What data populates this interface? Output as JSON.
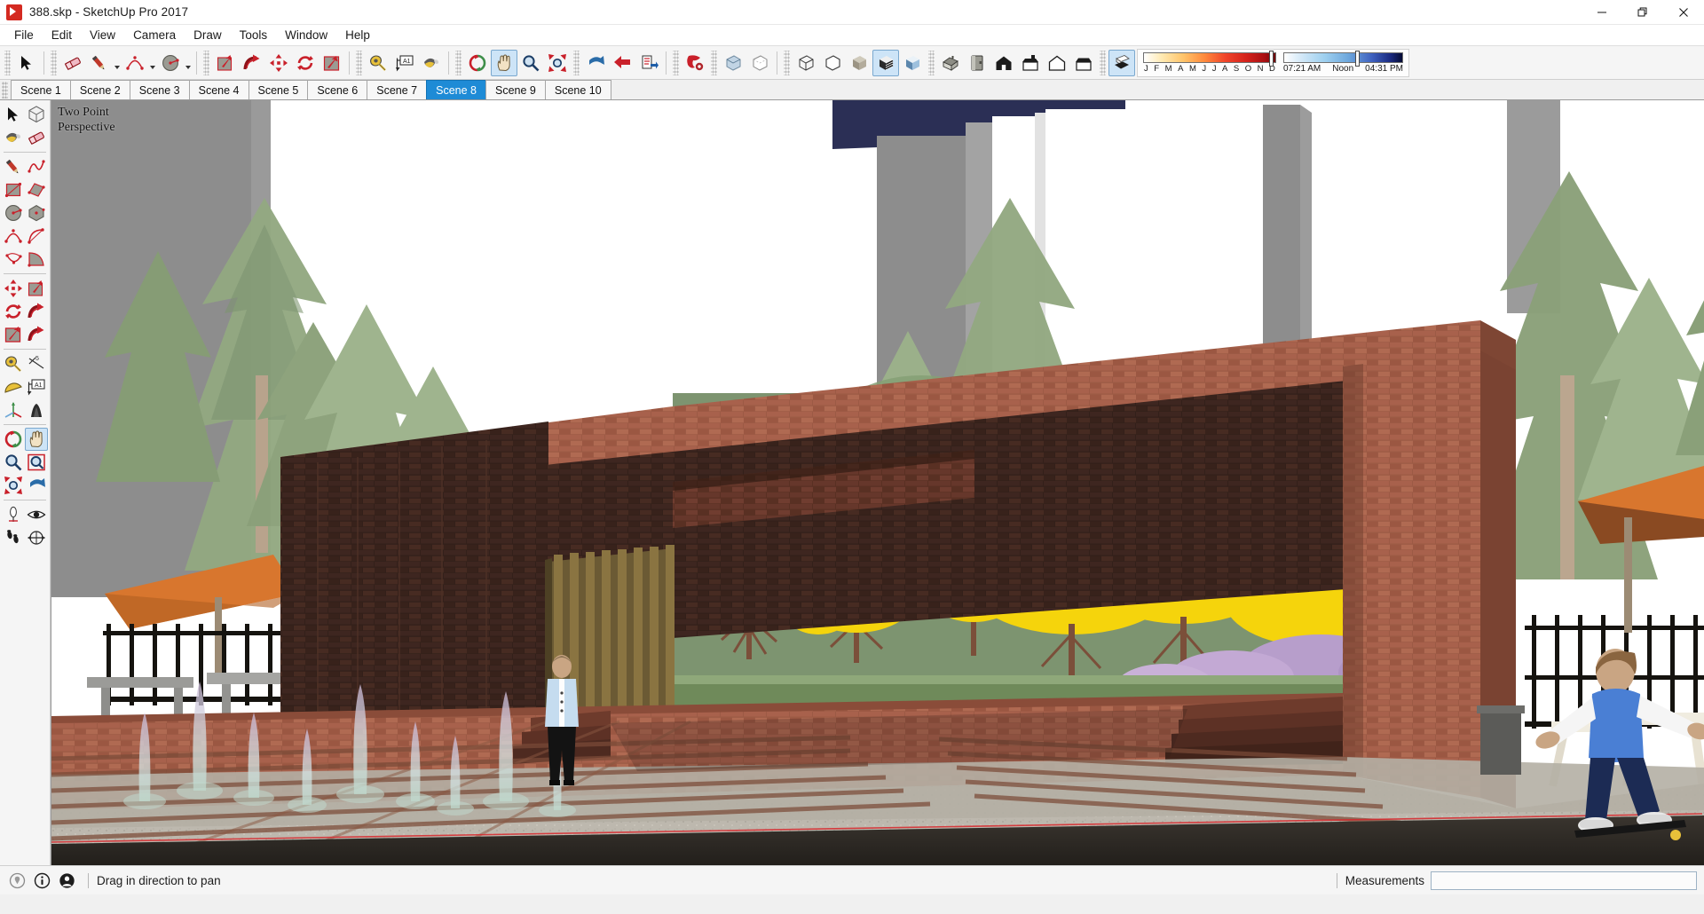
{
  "window": {
    "title": "388.skp - SketchUp Pro 2017",
    "app_icon": "sketchup-logo-icon",
    "minimize_label": "—",
    "maximize_label": "❐",
    "close_label": "✕"
  },
  "menubar": {
    "items": [
      {
        "label": "File"
      },
      {
        "label": "Edit"
      },
      {
        "label": "View"
      },
      {
        "label": "Camera"
      },
      {
        "label": "Draw"
      },
      {
        "label": "Tools"
      },
      {
        "label": "Window"
      },
      {
        "label": "Help"
      }
    ]
  },
  "toolbar_top": {
    "groups": [
      {
        "name": "select-group",
        "buttons": [
          {
            "name": "select-tool",
            "title": "Select",
            "icon": "arrow-cursor-icon",
            "active": false
          }
        ]
      },
      {
        "name": "draw-modify-group",
        "buttons": [
          {
            "name": "eraser-tool",
            "title": "Eraser",
            "icon": "eraser-icon",
            "active": false
          },
          {
            "name": "line-tool",
            "title": "Line",
            "icon": "pencil-icon",
            "active": false,
            "caret": true
          },
          {
            "name": "arc-tool",
            "title": "Arc",
            "icon": "arc-icon",
            "active": false,
            "caret": true
          },
          {
            "name": "circle-tool",
            "title": "Circle",
            "icon": "circle-shape-icon",
            "active": false,
            "caret": true
          }
        ]
      },
      {
        "name": "edit-group",
        "buttons": [
          {
            "name": "pushpull-tool",
            "title": "Push/Pull",
            "icon": "push-pull-icon",
            "active": false
          },
          {
            "name": "followme-tool",
            "title": "Follow Me",
            "icon": "follow-me-icon",
            "active": false
          },
          {
            "name": "move-tool",
            "title": "Move",
            "icon": "move-arrows-icon",
            "active": false
          },
          {
            "name": "rotate-tool",
            "title": "Rotate",
            "icon": "rotate-arrows-icon",
            "active": false
          },
          {
            "name": "offset-tool",
            "title": "Offset",
            "icon": "offset-icon",
            "active": false
          }
        ]
      },
      {
        "name": "construction-group",
        "buttons": [
          {
            "name": "tape-measure-tool",
            "title": "Tape Measure",
            "icon": "tape-measure-icon",
            "active": false
          },
          {
            "name": "text-tool",
            "title": "Text",
            "icon": "text-label-icon",
            "active": false
          },
          {
            "name": "paint-bucket-tool",
            "title": "Paint Bucket",
            "icon": "paint-bucket-icon",
            "active": false
          }
        ]
      },
      {
        "name": "camera-group",
        "buttons": [
          {
            "name": "orbit-tool",
            "title": "Orbit",
            "icon": "orbit-icon",
            "active": false
          },
          {
            "name": "pan-tool",
            "title": "Pan",
            "icon": "hand-pan-icon",
            "active": true
          },
          {
            "name": "zoom-tool",
            "title": "Zoom",
            "icon": "magnifier-icon",
            "active": false
          },
          {
            "name": "zoom-extents-tool",
            "title": "Zoom Extents",
            "icon": "zoom-extents-icon",
            "active": false
          }
        ]
      },
      {
        "name": "walkthrough-group",
        "buttons": [
          {
            "name": "previous-view",
            "title": "Previous",
            "icon": "previous-view-icon",
            "active": false
          },
          {
            "name": "next-view",
            "title": "Next",
            "icon": "next-view-icon",
            "active": false
          },
          {
            "name": "print-button",
            "title": "Print",
            "icon": "print-icon",
            "active": false
          }
        ]
      },
      {
        "name": "extensions-group",
        "buttons": [
          {
            "name": "extension-warehouse",
            "title": "Extension Warehouse",
            "icon": "extension-gear-icon",
            "active": false
          }
        ]
      },
      {
        "name": "view-style-group",
        "buttons": [
          {
            "name": "style-xray",
            "title": "X-ray",
            "icon": "xray-box-icon",
            "active": false
          },
          {
            "name": "style-backedges",
            "title": "Back Edges",
            "icon": "back-edges-icon",
            "active": false
          }
        ]
      },
      {
        "name": "face-style-group",
        "buttons": [
          {
            "name": "style-wireframe",
            "title": "Wireframe",
            "icon": "wireframe-box-icon",
            "active": false
          },
          {
            "name": "style-hiddenline",
            "title": "Hidden Line",
            "icon": "hidden-line-box-icon",
            "active": false
          },
          {
            "name": "style-shaded",
            "title": "Shaded",
            "icon": "shaded-box-icon",
            "active": false
          },
          {
            "name": "style-texture",
            "title": "Shaded With Textures",
            "icon": "textured-box-icon",
            "active": true
          },
          {
            "name": "style-monochrome",
            "title": "Monochrome",
            "icon": "monochrome-box-icon",
            "active": false
          }
        ]
      },
      {
        "name": "standard-views-group",
        "buttons": [
          {
            "name": "view-iso",
            "title": "Iso",
            "icon": "iso-house-icon",
            "active": false
          },
          {
            "name": "view-top",
            "title": "Top",
            "icon": "top-view-icon",
            "active": false
          },
          {
            "name": "view-front",
            "title": "Front",
            "icon": "front-house-icon",
            "active": false
          },
          {
            "name": "view-right",
            "title": "Right",
            "icon": "right-house-icon",
            "active": false
          },
          {
            "name": "view-back",
            "title": "Back",
            "icon": "back-house-icon",
            "active": false
          },
          {
            "name": "view-left",
            "title": "Left",
            "icon": "left-house-icon",
            "active": false
          }
        ]
      },
      {
        "name": "shadow-group",
        "buttons": [
          {
            "name": "shadow-toggle",
            "title": "Show/Hide Shadows",
            "icon": "shadow-box-icon",
            "active": true
          }
        ]
      }
    ],
    "shadow_widget": {
      "month_labels": [
        "J",
        "F",
        "M",
        "A",
        "M",
        "J",
        "J",
        "A",
        "S",
        "O",
        "N",
        "D"
      ],
      "month_value": "D",
      "time_start": "07:21 AM",
      "time_noon": "Noon",
      "time_end": "04:31 PM"
    }
  },
  "scene_tabs": {
    "tabs": [
      {
        "label": "Scene 1",
        "active": false
      },
      {
        "label": "Scene 2",
        "active": false
      },
      {
        "label": "Scene 3",
        "active": false
      },
      {
        "label": "Scene 4",
        "active": false
      },
      {
        "label": "Scene 5",
        "active": false
      },
      {
        "label": "Scene 6",
        "active": false
      },
      {
        "label": "Scene 7",
        "active": false
      },
      {
        "label": "Scene 8",
        "active": true
      },
      {
        "label": "Scene 9",
        "active": false
      },
      {
        "label": "Scene 10",
        "active": false
      }
    ]
  },
  "toolbar_left": {
    "rows": [
      {
        "sep_after": false,
        "buttons": [
          {
            "name": "select-tool-left",
            "title": "Select",
            "icon": "arrow-cursor-icon",
            "active": false
          },
          {
            "name": "make-component-tool",
            "title": "Make Component",
            "icon": "component-box-icon",
            "active": false
          }
        ]
      },
      {
        "sep_after": true,
        "buttons": [
          {
            "name": "paint-bucket-tool-left",
            "title": "Paint Bucket",
            "icon": "paint-bucket-icon",
            "active": false
          },
          {
            "name": "eraser-tool-left",
            "title": "Eraser",
            "icon": "eraser-icon",
            "active": false
          }
        ]
      },
      {
        "sep_after": false,
        "buttons": [
          {
            "name": "line-tool-left",
            "title": "Line",
            "icon": "pencil-icon",
            "active": false
          },
          {
            "name": "freehand-tool",
            "title": "Freehand",
            "icon": "freehand-squiggle-icon",
            "active": false
          }
        ]
      },
      {
        "sep_after": false,
        "buttons": [
          {
            "name": "rectangle-tool",
            "title": "Rectangle",
            "icon": "rectangle-icon",
            "active": false
          },
          {
            "name": "rotated-rectangle-tool",
            "title": "Rotated Rectangle",
            "icon": "rotated-rectangle-icon",
            "active": false
          }
        ]
      },
      {
        "sep_after": false,
        "buttons": [
          {
            "name": "circle-tool-left",
            "title": "Circle",
            "icon": "circle-shape-icon",
            "active": false
          },
          {
            "name": "polygon-tool",
            "title": "Polygon",
            "icon": "polygon-icon",
            "active": false
          }
        ]
      },
      {
        "sep_after": false,
        "buttons": [
          {
            "name": "arc-tool-left",
            "title": "Arc",
            "icon": "arc-icon",
            "active": false
          },
          {
            "name": "two-point-arc-tool",
            "title": "2 Point Arc",
            "icon": "two-point-arc-icon",
            "active": false
          }
        ]
      },
      {
        "sep_after": true,
        "buttons": [
          {
            "name": "three-point-arc-tool",
            "title": "3 Point Arc",
            "icon": "three-point-arc-icon",
            "active": false
          },
          {
            "name": "pie-tool",
            "title": "Pie",
            "icon": "pie-icon",
            "active": false
          }
        ]
      },
      {
        "sep_after": false,
        "buttons": [
          {
            "name": "move-tool-left",
            "title": "Move",
            "icon": "move-arrows-icon",
            "active": false
          },
          {
            "name": "pushpull-tool-left",
            "title": "Push/Pull",
            "icon": "push-pull-icon",
            "active": false
          }
        ]
      },
      {
        "sep_after": false,
        "buttons": [
          {
            "name": "rotate-tool-left",
            "title": "Rotate",
            "icon": "rotate-arrows-icon",
            "active": false
          },
          {
            "name": "followme-tool-left",
            "title": "Follow Me",
            "icon": "follow-me-icon",
            "active": false
          }
        ]
      },
      {
        "sep_after": true,
        "buttons": [
          {
            "name": "scale-tool",
            "title": "Scale",
            "icon": "scale-box-icon",
            "active": false
          },
          {
            "name": "followme-tool-alt",
            "title": "Follow Me",
            "icon": "follow-me-icon",
            "active": false
          }
        ]
      },
      {
        "sep_after": false,
        "buttons": [
          {
            "name": "tape-measure-tool-left",
            "title": "Tape Measure",
            "icon": "tape-measure-icon",
            "active": false
          },
          {
            "name": "dimension-tool",
            "title": "Dimensions",
            "icon": "dimension-icon",
            "active": false
          }
        ]
      },
      {
        "sep_after": false,
        "buttons": [
          {
            "name": "protractor-tool",
            "title": "Protractor",
            "icon": "protractor-icon",
            "active": false
          },
          {
            "name": "text-tool-left",
            "title": "Text",
            "icon": "text-label-icon",
            "active": false
          }
        ]
      },
      {
        "sep_after": true,
        "buttons": [
          {
            "name": "axes-tool",
            "title": "Axes",
            "icon": "axes-icon",
            "active": false
          },
          {
            "name": "three-d-text-tool",
            "title": "3D Text",
            "icon": "three-d-text-icon",
            "active": false
          }
        ]
      },
      {
        "sep_after": false,
        "buttons": [
          {
            "name": "orbit-tool-left",
            "title": "Orbit",
            "icon": "orbit-icon",
            "active": false
          },
          {
            "name": "pan-tool-left",
            "title": "Pan",
            "icon": "hand-pan-icon",
            "active": true
          }
        ]
      },
      {
        "sep_after": false,
        "buttons": [
          {
            "name": "zoom-tool-left",
            "title": "Zoom",
            "icon": "magnifier-icon",
            "active": false
          },
          {
            "name": "zoom-window-tool",
            "title": "Zoom Window",
            "icon": "zoom-window-icon",
            "active": false
          }
        ]
      },
      {
        "sep_after": true,
        "buttons": [
          {
            "name": "zoom-extents-tool-left",
            "title": "Zoom Extents",
            "icon": "zoom-extents-icon",
            "active": false
          },
          {
            "name": "previous-view-left",
            "title": "Previous View",
            "icon": "previous-view-icon",
            "active": false
          }
        ]
      },
      {
        "sep_after": false,
        "buttons": [
          {
            "name": "position-camera-tool",
            "title": "Position Camera",
            "icon": "position-camera-icon",
            "active": false
          },
          {
            "name": "look-around-tool",
            "title": "Look Around",
            "icon": "eye-look-around-icon",
            "active": false
          }
        ]
      },
      {
        "sep_after": false,
        "buttons": [
          {
            "name": "walk-tool",
            "title": "Walk",
            "icon": "walk-footprints-icon",
            "active": false
          },
          {
            "name": "section-plane-tool",
            "title": "Section Plane",
            "icon": "section-plane-icon",
            "active": false
          }
        ]
      }
    ]
  },
  "viewport": {
    "camera_label_line1": "Two Point",
    "camera_label_line2": "Perspective",
    "scene_description": "Exterior architectural rendering: brick pavilion with cantilevered roof beam, wooden slat screen wall, brick retaining wall with steps, plaza with water jet fountains, flowering trees, iron fence, cafe umbrellas, picnic tables, pedestrian in light blue shirt on steps, skateboarder in blue shirt at right, white office towers and evergreen trees in background, dark navy sky band.",
    "colors": {
      "sky": "#2b2f55",
      "sky_white": "#ffffff",
      "brick_light": "#a8614c",
      "brick_dark": "#3a211a",
      "brick_mid": "#6b392c",
      "foliage_green": "#93a982",
      "foliage_dark": "#5e7350",
      "blossom_yellow": "#f5d40c",
      "blossom_pink": "#e3a6bb",
      "blossom_purple": "#b79ecb",
      "pavement": "#bdb8ae",
      "pavement_dark": "#8e8983",
      "umbrella_orange": "#d8762e",
      "shirt_blue": "#4a7fd4",
      "water_jet": "#d9e8e2",
      "tower_grey": "#8d8d8d",
      "ground_dark": "#2e2a26"
    }
  },
  "statusbar": {
    "icons": [
      {
        "name": "geo-location-icon",
        "title": "Geo-location"
      },
      {
        "name": "info-circle-icon",
        "title": "Instructor"
      },
      {
        "name": "user-account-icon",
        "title": "Sign In"
      }
    ],
    "hint_text": "Drag in direction to pan",
    "measurements_label": "Measurements",
    "measurements_value": "",
    "measurements_placeholder": ""
  }
}
